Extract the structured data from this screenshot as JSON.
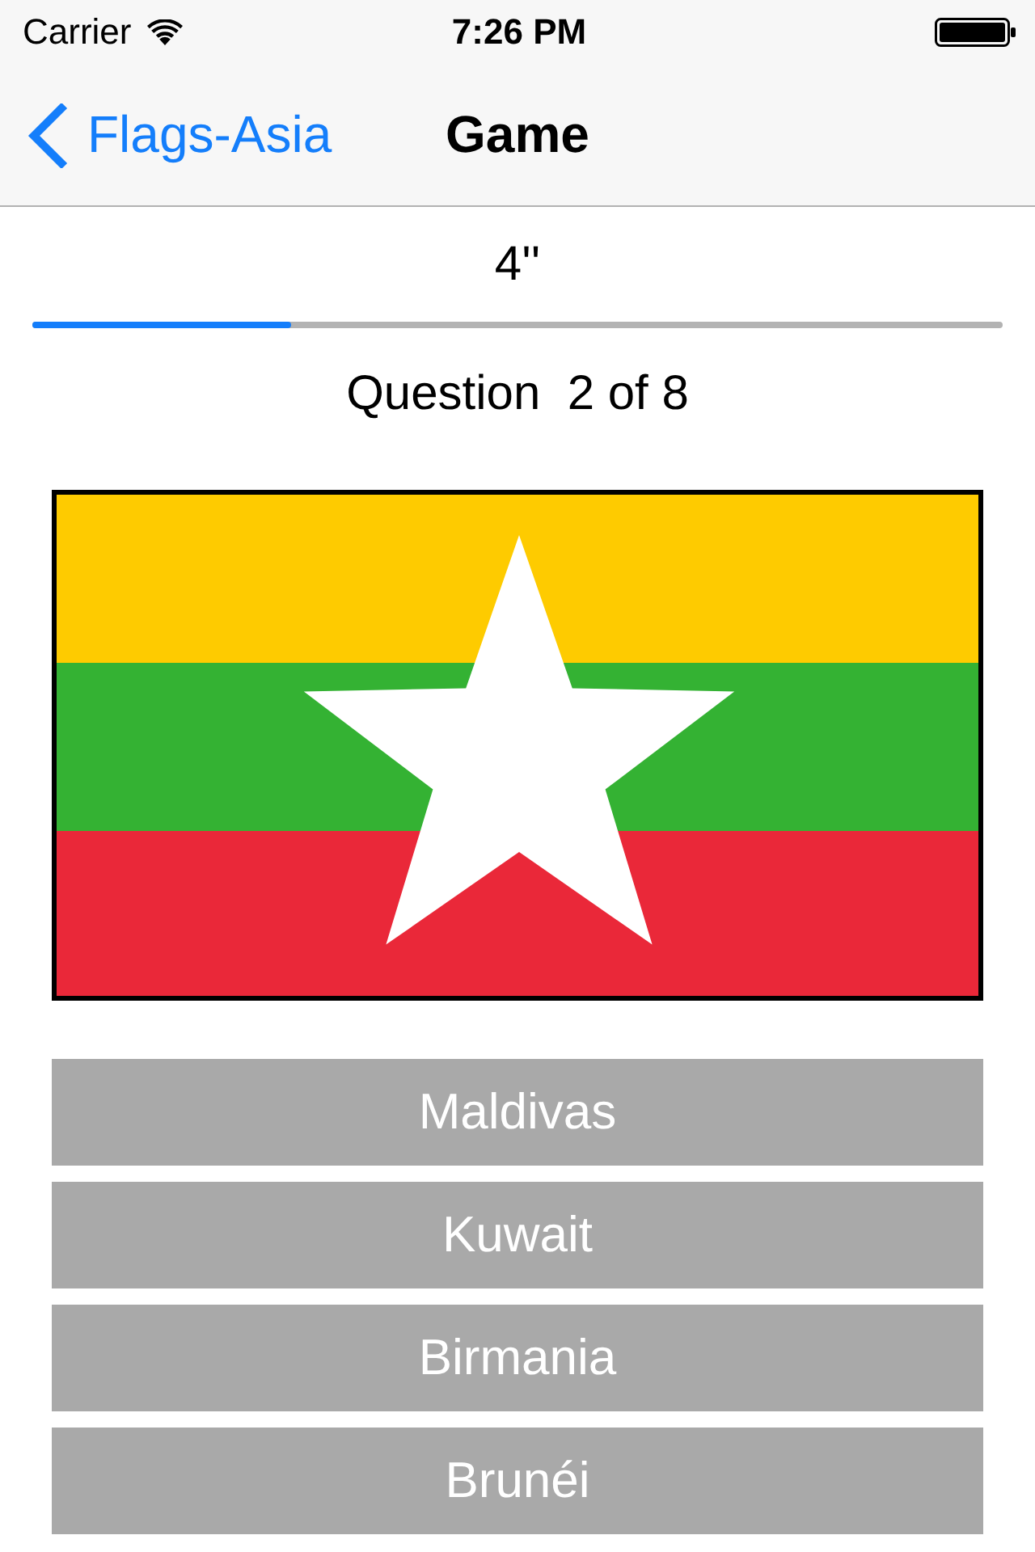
{
  "status_bar": {
    "carrier": "Carrier",
    "time": "7:26 PM"
  },
  "nav_bar": {
    "back_label": "Flags-Asia",
    "title": "Game"
  },
  "timer": {
    "reading": "4''",
    "level": 0.267
  },
  "question": "Question  2 of 8",
  "answers": [
    {
      "label": "Maldivas"
    },
    {
      "label": "Kuwait"
    },
    {
      "label": "Birmania"
    },
    {
      "label": "Brunéi"
    }
  ]
}
